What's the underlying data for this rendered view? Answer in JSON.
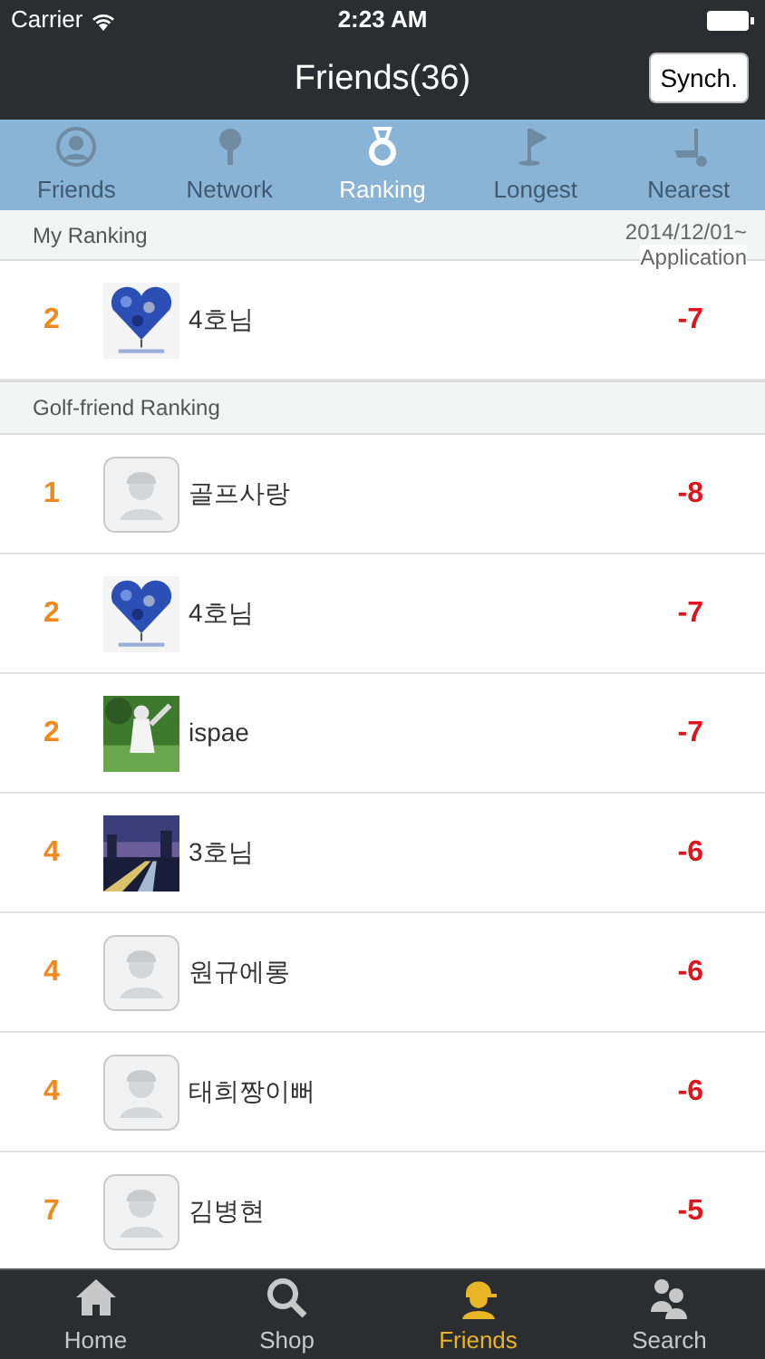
{
  "status_bar": {
    "carrier": "Carrier",
    "time": "2:23 AM"
  },
  "nav_bar": {
    "title": "Friends(36)",
    "button": "Synch."
  },
  "tabs": [
    {
      "label": "Friends",
      "selected": false,
      "kind": "friend"
    },
    {
      "label": "Network",
      "selected": false,
      "kind": "tee"
    },
    {
      "label": "Ranking",
      "selected": true,
      "kind": "medal"
    },
    {
      "label": "Longest",
      "selected": false,
      "kind": "flag"
    },
    {
      "label": "Nearest",
      "selected": false,
      "kind": "putter"
    }
  ],
  "my_ranking": {
    "header": "My Ranking",
    "period": "2014/12/01~",
    "period_note": "Application",
    "rows": [
      {
        "rank": "2",
        "name": "4호님",
        "score": "-7",
        "kind": "picture"
      }
    ]
  },
  "friend_ranking": {
    "header": "Golf-friend Ranking",
    "rows": [
      {
        "rank": "1",
        "name": "골프사랑",
        "score": "-8",
        "kind": "default"
      },
      {
        "rank": "2",
        "name": "4호님",
        "score": "-7",
        "kind": "picture"
      },
      {
        "rank": "2",
        "name": "ispae",
        "score": "-7",
        "kind": "picture"
      },
      {
        "rank": "4",
        "name": "3호님",
        "score": "-6",
        "kind": "picture"
      },
      {
        "rank": "4",
        "name": "원규에롱",
        "score": "-6",
        "kind": "default"
      },
      {
        "rank": "4",
        "name": "태희짱이뻐",
        "score": "-6",
        "kind": "default"
      },
      {
        "rank": "7",
        "name": "김병현",
        "score": "-5",
        "kind": "default"
      }
    ]
  },
  "bottom_tabs": [
    {
      "label": "Home",
      "selected": false,
      "kind": "home"
    },
    {
      "label": "Shop",
      "selected": false,
      "kind": "search"
    },
    {
      "label": "Friends",
      "selected": true,
      "kind": "friend"
    },
    {
      "label": "Search",
      "selected": false,
      "kind": "people"
    }
  ]
}
